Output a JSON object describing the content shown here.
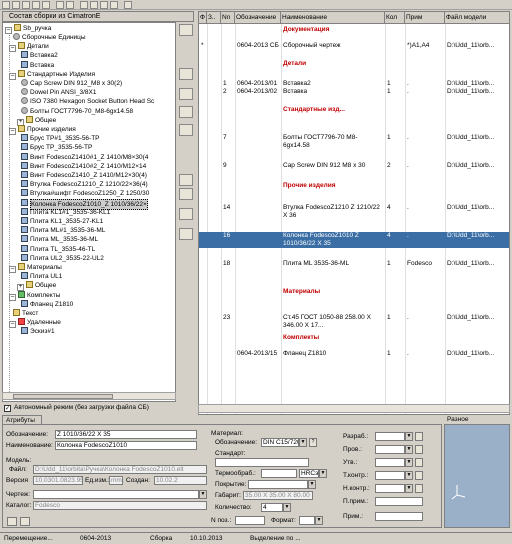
{
  "tree": {
    "title": "Состав сборки из CimatronE",
    "root": "Sb_ручка",
    "nodes": [
      {
        "label": "Сборочные Единицы"
      },
      {
        "label": "Детали"
      },
      {
        "label": "Вставка2"
      },
      {
        "label": "Вставка"
      },
      {
        "label": "Стандартные Изделия"
      },
      {
        "label": "Cap Screw DIN 912_M8 x 30(2)"
      },
      {
        "label": "Dowel Pin ANSI_3/8X1"
      },
      {
        "label": "ISO 7380 Hexagon Socket Button Head Sc"
      },
      {
        "label": "Болты ГОСТ7796-70_M8-6gx14.58"
      },
      {
        "label": "Общее"
      },
      {
        "label": "Прочие изделия"
      },
      {
        "label": "Брус ТР#1_3535-56-TP"
      },
      {
        "label": "Брус TP_3535-56-TP"
      },
      {
        "label": "Винт FodescoZ1410#1_Z 1410/M8×30(4"
      },
      {
        "label": "Винт FodescoZ1410#2_Z 1410/M12×14"
      },
      {
        "label": "Винт FodescoZ1410_Z 1410/M12×30(4)"
      },
      {
        "label": "Втулка FodescoZ1210_Z 1210/22×36(4)"
      },
      {
        "label": "Втулка#шифт FodescoZ1250_Z 1250/30"
      },
      {
        "label": "Колонка FodescoZ1010_Z 1010/36/22×"
      },
      {
        "label": "Плита KL1#1_3535-36-KL1"
      },
      {
        "label": "Плита KL1_3535-27-KL1"
      },
      {
        "label": "Плита ML#1_3535-36-ML"
      },
      {
        "label": "Плита ML_3535-36-ML"
      },
      {
        "label": "Плита TL_3535-46-TL"
      },
      {
        "label": "Плита UL2_3535-22-UL2"
      },
      {
        "label": "Материалы"
      },
      {
        "label": "Плита UL1"
      },
      {
        "label": "Общее"
      },
      {
        "label": "Комплекты"
      },
      {
        "label": "Фланец Z1810"
      },
      {
        "label": "Текст"
      },
      {
        "label": "Удаленные"
      },
      {
        "label": "Эскиз#1"
      }
    ]
  },
  "autonomous_label": "Автономный режим (без загрузки файла СБ)",
  "spec": {
    "columns": [
      "Ф",
      "З..",
      "Nn",
      "Обозначение",
      "Наименование",
      "Кол",
      "Прим",
      "Файл модели"
    ],
    "rows": [
      {
        "kind": "hdr",
        "name": "Документация"
      },
      {
        "f": "*",
        "z": "",
        "n": "",
        "oboz": "0604-2013 СБ",
        "name": "Сборочный чертеж",
        "kol": "",
        "prim": "*)A1,A4",
        "file": "D:\\Udd_11\\orb..."
      },
      {
        "kind": "hdr",
        "name": "Детали"
      },
      {
        "f": "",
        "z": "",
        "n": "1",
        "oboz": "0604-2013/01",
        "name": "Вставка2",
        "kol": "1",
        "prim": ".",
        "file": "D:\\Udd_11\\orb..."
      },
      {
        "f": "",
        "z": "",
        "n": "2",
        "oboz": "0604-2013/02",
        "name": "Вставка",
        "kol": "1",
        "prim": ".",
        "file": "D:\\Udd_11\\orb..."
      },
      {
        "kind": "hdr",
        "name": "Стандартные изд..."
      },
      {
        "f": "",
        "z": "",
        "n": "7",
        "oboz": "",
        "name": "Болты ГОСТ7796-70 M8-6gx14.58",
        "kol": "1",
        "prim": ".",
        "file": "D:\\Udd_11\\orb..."
      },
      {
        "f": "",
        "z": "",
        "n": "9",
        "oboz": "",
        "name": "Cap Screw DIN 912 M8 x 30",
        "kol": "2",
        "prim": ".",
        "file": "D:\\Udd_11\\orb..."
      },
      {
        "kind": "hdr",
        "name": "Прочие изделия"
      },
      {
        "f": "",
        "z": "",
        "n": "14",
        "oboz": "",
        "name": "Втулка FodescoZ1210 Z 1210/22 X 36",
        "kol": "4",
        "prim": ".",
        "file": "D:\\Udd_11\\orb..."
      },
      {
        "kind": "sel",
        "f": "",
        "z": "",
        "n": "16",
        "oboz": "",
        "name": "Колонка FodescoZ1010 Z 1010/36/22 X 35",
        "kol": "4",
        "prim": ".",
        "file": "D:\\Udd_11\\orb..."
      },
      {
        "f": "",
        "z": "",
        "n": "18",
        "oboz": "",
        "name": "Плита ML 3535-36-ML",
        "kol": "1",
        "prim": "Fodesco",
        "file": "D:\\Udd_11\\orb..."
      },
      {
        "kind": "hdr",
        "name": "Материалы"
      },
      {
        "f": "",
        "z": "",
        "n": "23",
        "oboz": "",
        "name": "Ст.45 ГОСТ 1050-88 258.00 X 346.00 X 17...",
        "kol": "1",
        "prim": ".",
        "file": "D:\\Udd_11\\orb..."
      },
      {
        "kind": "hdr",
        "name": "Комплекты"
      },
      {
        "f": "",
        "z": "",
        "n": "",
        "oboz": "0604-2013/15",
        "name": "Фланец Z1810",
        "kol": "1",
        "prim": ".",
        "file": "D:\\Udd_11\\orb..."
      }
    ]
  },
  "attributes": {
    "tab_label": "Атрибуты",
    "oboznachenie_label": "Обозначение:",
    "oboznachenie_value": "Z 1010/36/22 X 35",
    "naimenovanie_label": "Наименование:",
    "naimenovanie_value": "Колонка FodescoZ1010",
    "model_label": "Модель:",
    "file_label": "Файл:",
    "file_value": "D:\\Udd_11\\orbita\\Ручка\\Колонка FodescoZ1010.elt",
    "version_label": "Версия",
    "version_value": "10.0301.0823.950",
    "unit_label": "Ед.изм.:",
    "unit_value": "mm",
    "created_label": "Создан:",
    "created_value": "10.02.2",
    "drawing_label": "Чертеж:",
    "catalog_label": "Каталог:",
    "catalog_value": "Fodesco",
    "material_label": "Материал:",
    "mat_oboz_label": "Обозначение:",
    "mat_oboz_value": "DIN C15/720H",
    "standard_label": "Стандарт:",
    "heat_label": "Термообраб.:",
    "heat_value": "HRCэ",
    "coating_label": "Покрытие:",
    "gabarit_label": "Габарит:",
    "gabarit_value": "35.00 X 35.00 X 80.00",
    "qty_label": "Количество:",
    "qty_value": "4",
    "npos_label": "N поз.:",
    "format_label": "Формат:",
    "razrab_label": "Разраб.:",
    "prov_label": "Пров.:",
    "utv_label": "Утв.:",
    "tkontr_label": "Т.контр.:",
    "nkontr_label": "Н.контр.:",
    "primen_label": "П.прим.:",
    "prim_label": "Прим.:"
  },
  "preview_label": "Разное",
  "status": {
    "left": "Перемещение...",
    "mid1": "0604-2013",
    "mid2": "Сборка",
    "mid3": "10.10.2013",
    "right": "Выделение по ..."
  }
}
